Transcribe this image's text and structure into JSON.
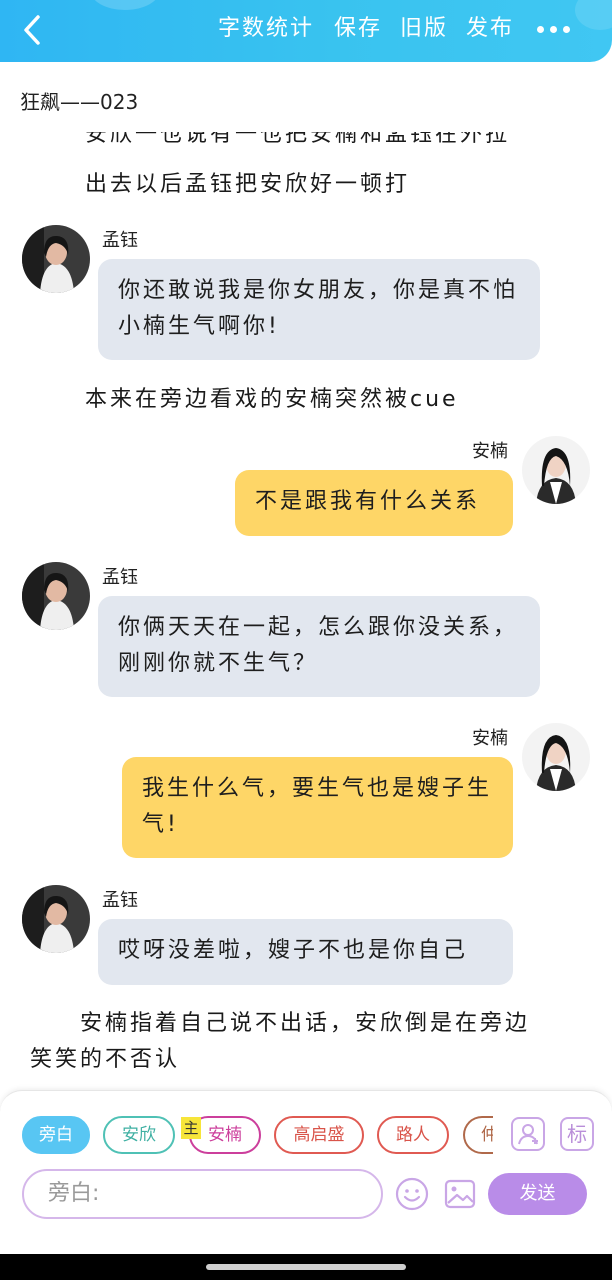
{
  "toolbar": {
    "word_count": "字数统计",
    "save": "保存",
    "old_version": "旧版",
    "publish": "发布"
  },
  "doc": {
    "title": "狂飙——023"
  },
  "content": {
    "clipped_line": "安欣一也说有一也把安楠和孟钰在外拉",
    "narration_1": "出去以后孟钰把安欣好一顿打",
    "msg1": {
      "speaker": "孟钰",
      "text": "你还敢说我是你女朋友，你是真不怕小楠生气啊你!"
    },
    "narration_2": "本来在旁边看戏的安楠突然被cue",
    "msg2": {
      "speaker": "安楠",
      "text": "不是跟我有什么关系"
    },
    "msg3": {
      "speaker": "孟钰",
      "text": "你俩天天在一起，怎么跟你没关系，刚刚你就不生气？"
    },
    "msg4": {
      "speaker": "安楠",
      "text": "我生什么气，要生气也是嫂子生气!"
    },
    "msg5": {
      "speaker": "孟钰",
      "text": "哎呀没差啦，嫂子不也是你自己"
    },
    "narration_3_line1": "　　安楠指着自己说不出话，安欣倒是在旁边",
    "narration_3_line2": "笑笑的不否认"
  },
  "roles": {
    "narrator": "旁白",
    "anxin": "安欣",
    "annan": "安楠",
    "main_tag": "主",
    "gaoqisheng": "高启盛",
    "passerby": "路人",
    "cut": "仲"
  },
  "composer": {
    "placeholder": "旁白:",
    "send": "发送",
    "mark_label": "标"
  },
  "colors": {
    "topbar": "#2fb6f3",
    "bubble_left": "#e2e7ef",
    "bubble_right": "#fed667",
    "send_button": "#b98ce8"
  },
  "icons": [
    "back-arrow-icon",
    "more-icon",
    "role-icon",
    "emoji-icon",
    "image-icon"
  ]
}
